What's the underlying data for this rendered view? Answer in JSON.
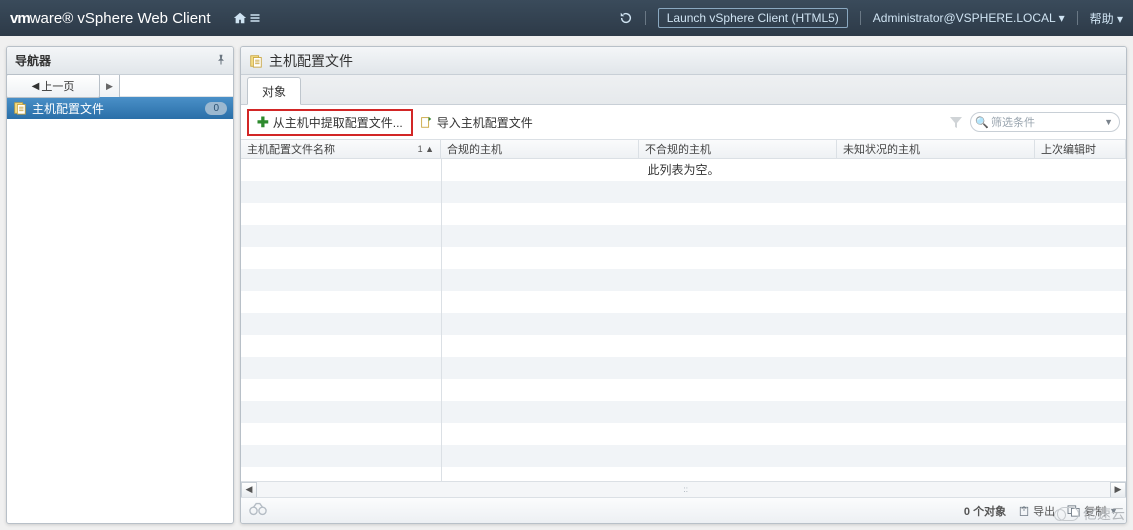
{
  "top": {
    "brand_bold": "vm",
    "brand_rest": "ware® vSphere Web Client",
    "launch_html5": "Launch vSphere Client (HTML5)",
    "user": "Administrator@VSPHERE.LOCAL",
    "help": "帮助"
  },
  "nav": {
    "title": "导航器",
    "back": "上一页",
    "item": "主机配置文件",
    "item_count": "0"
  },
  "main": {
    "title": "主机配置文件",
    "tab": "对象",
    "action_extract": "从主机中提取配置文件...",
    "action_import": "导入主机配置文件",
    "filter_placeholder": "筛选条件",
    "columns": {
      "c1": "主机配置文件名称",
      "c1_sort": "1 ▲",
      "c2": "合规的主机",
      "c3": "不合规的主机",
      "c4": "未知状况的主机",
      "c5": "上次编辑时"
    },
    "empty": "此列表为空。",
    "object_count": "0 个对象",
    "export": "导出",
    "copy": "复制"
  },
  "watermark": "亿速云"
}
